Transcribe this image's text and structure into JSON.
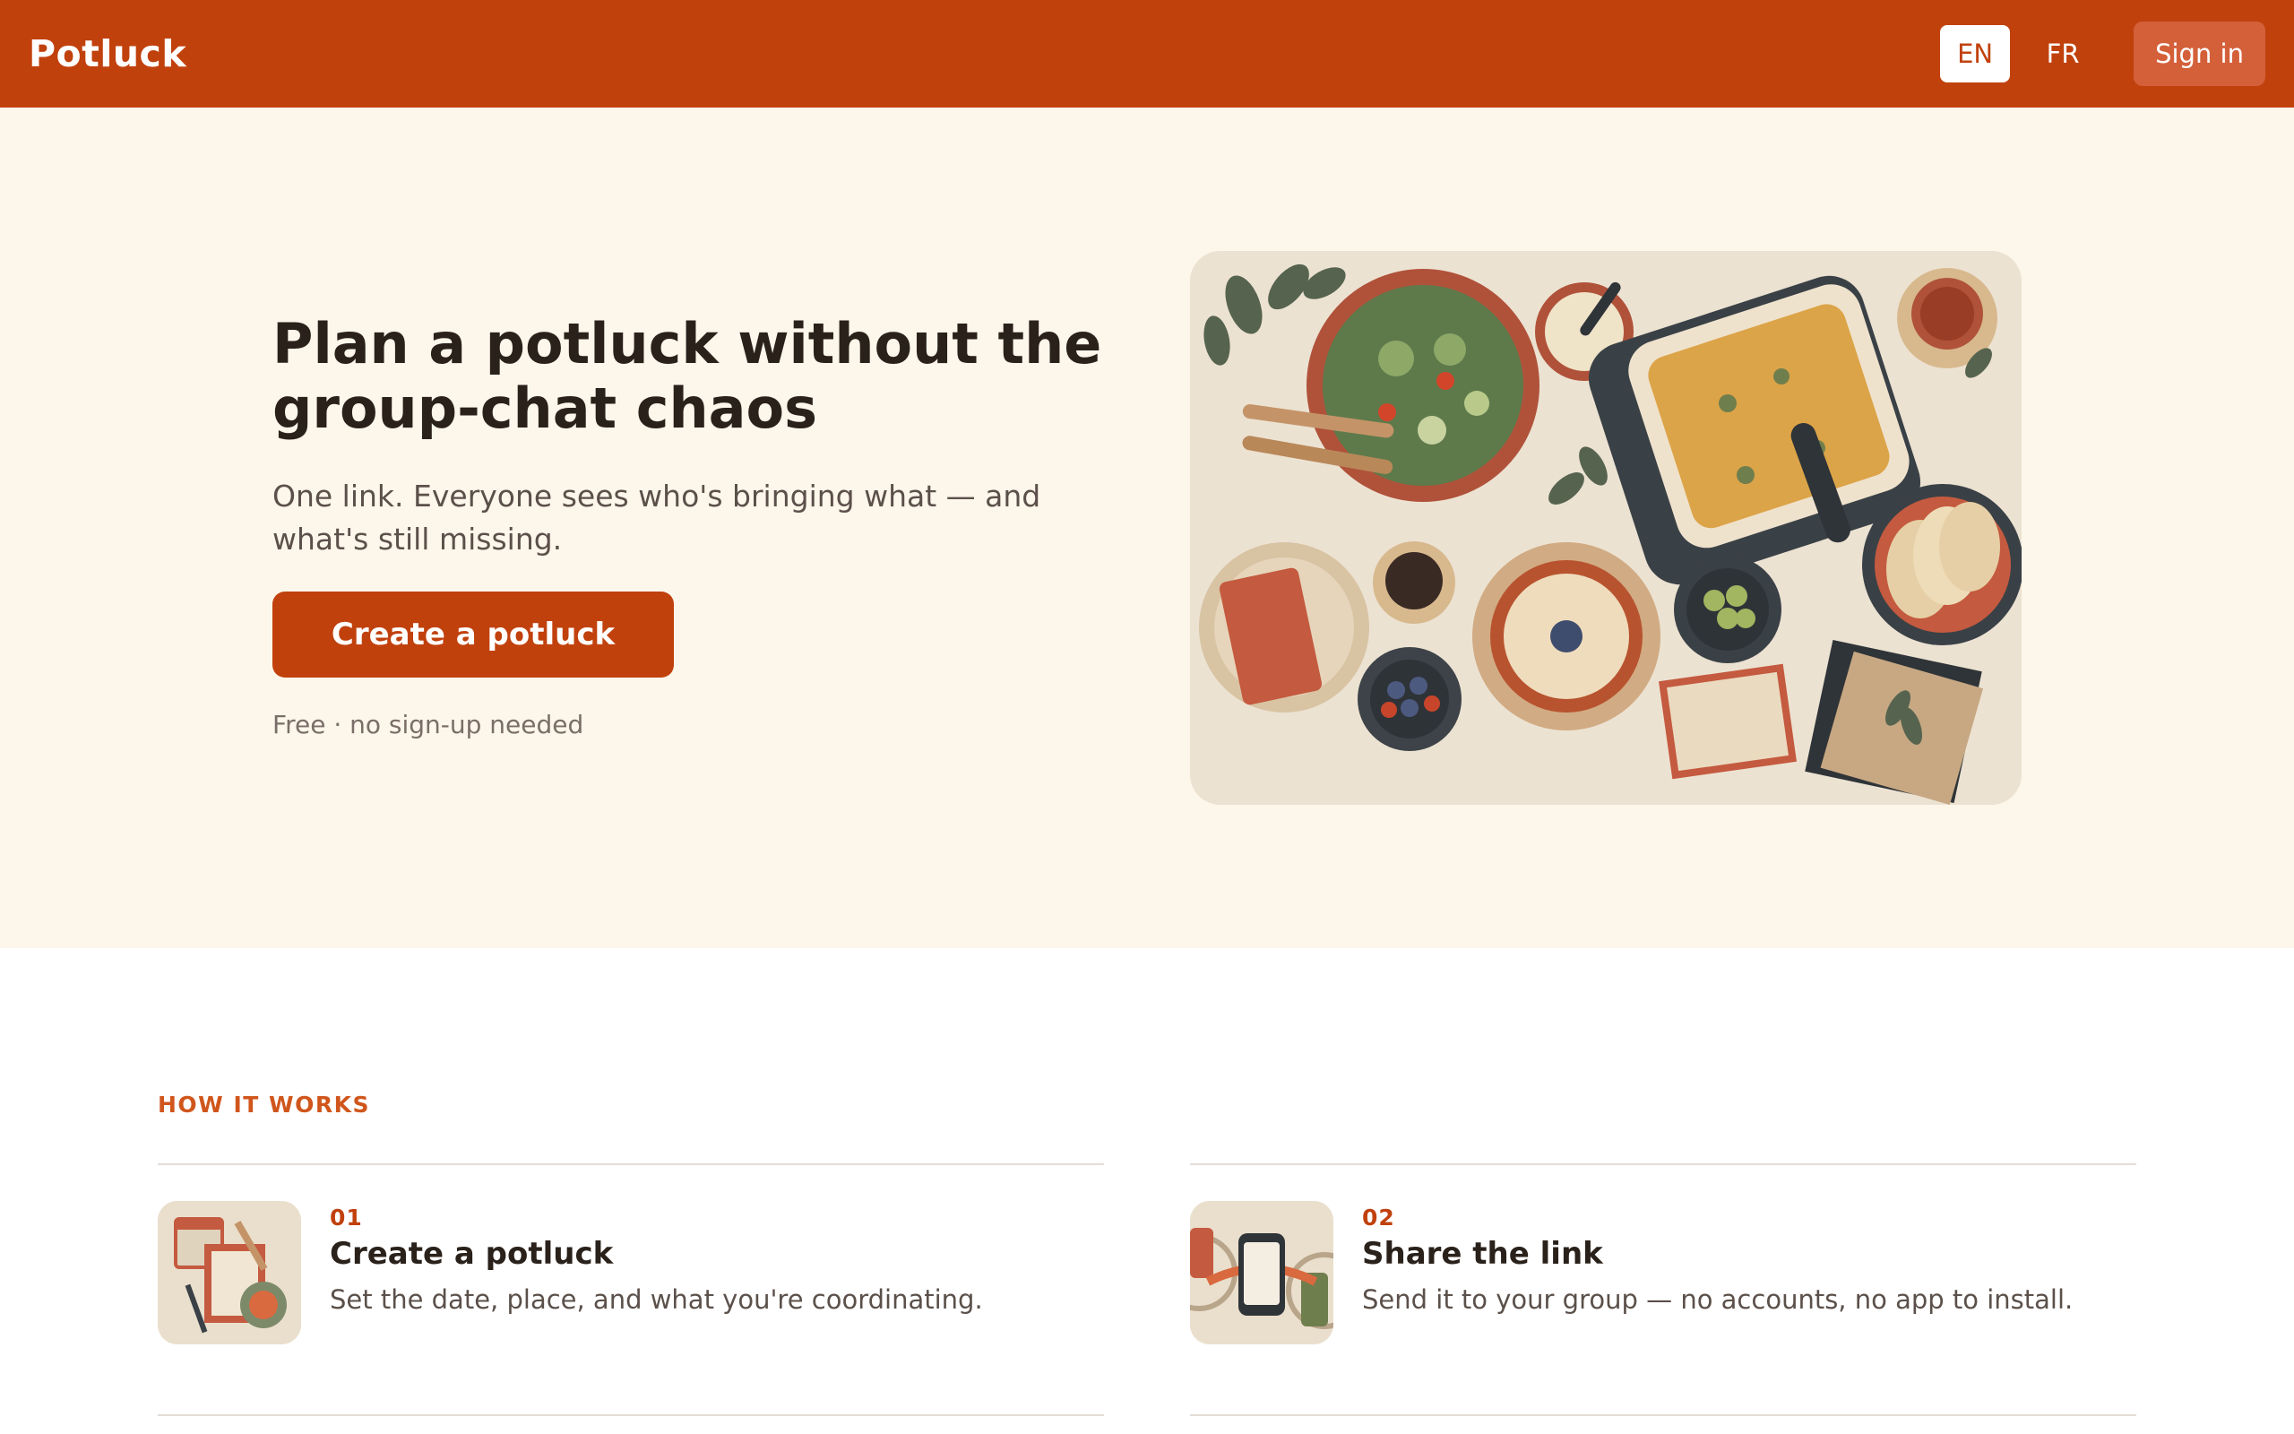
{
  "header": {
    "brand": "Potluck",
    "lang_en": "EN",
    "lang_fr": "FR",
    "sign_in": "Sign in"
  },
  "hero": {
    "title": "Plan a potluck without the group-chat chaos",
    "subtitle": "One link. Everyone sees who's bringing what — and what's still missing.",
    "cta": "Create a potluck",
    "note": "Free · no sign-up needed"
  },
  "how": {
    "label": "HOW IT WORKS",
    "steps": [
      {
        "num": "01",
        "title": "Create a potluck",
        "desc": "Set the date, place, and what you're coordinating."
      },
      {
        "num": "02",
        "title": "Share the link",
        "desc": "Send it to your group — no accounts, no app to install."
      }
    ]
  },
  "colors": {
    "brand": "#c1410d",
    "hero_bg": "#fdf6ea",
    "accent_label": "#d0561c"
  }
}
